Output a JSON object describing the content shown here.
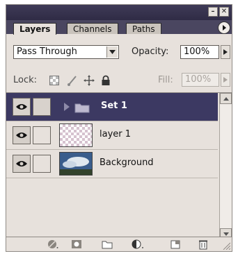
{
  "window": {
    "minimize_glyph": "–",
    "close_glyph": "✕"
  },
  "tabs": [
    {
      "label": "Layers"
    },
    {
      "label": "Channels"
    },
    {
      "label": "Paths"
    }
  ],
  "blend": {
    "mode": "Pass Through",
    "opacity_label": "Opacity:",
    "opacity_value": "100%"
  },
  "lock": {
    "label": "Lock:",
    "fill_label": "Fill:",
    "fill_value": "100%"
  },
  "layers": [
    {
      "name": "Set 1",
      "type": "group",
      "selected": true
    },
    {
      "name": "layer 1",
      "type": "transparent"
    },
    {
      "name": "Background",
      "type": "image"
    }
  ],
  "icons": {
    "layer_style": "layer-style-icon",
    "mask": "add-mask-icon",
    "new_set": "new-set-icon",
    "adjustment": "adjustment-layer-icon",
    "new_layer": "new-layer-icon",
    "trash": "trash-icon"
  },
  "colors": {
    "selected_row": "#3c3962",
    "title_bar": "#3f3b57",
    "panel_bg": "#e7e1dc"
  }
}
